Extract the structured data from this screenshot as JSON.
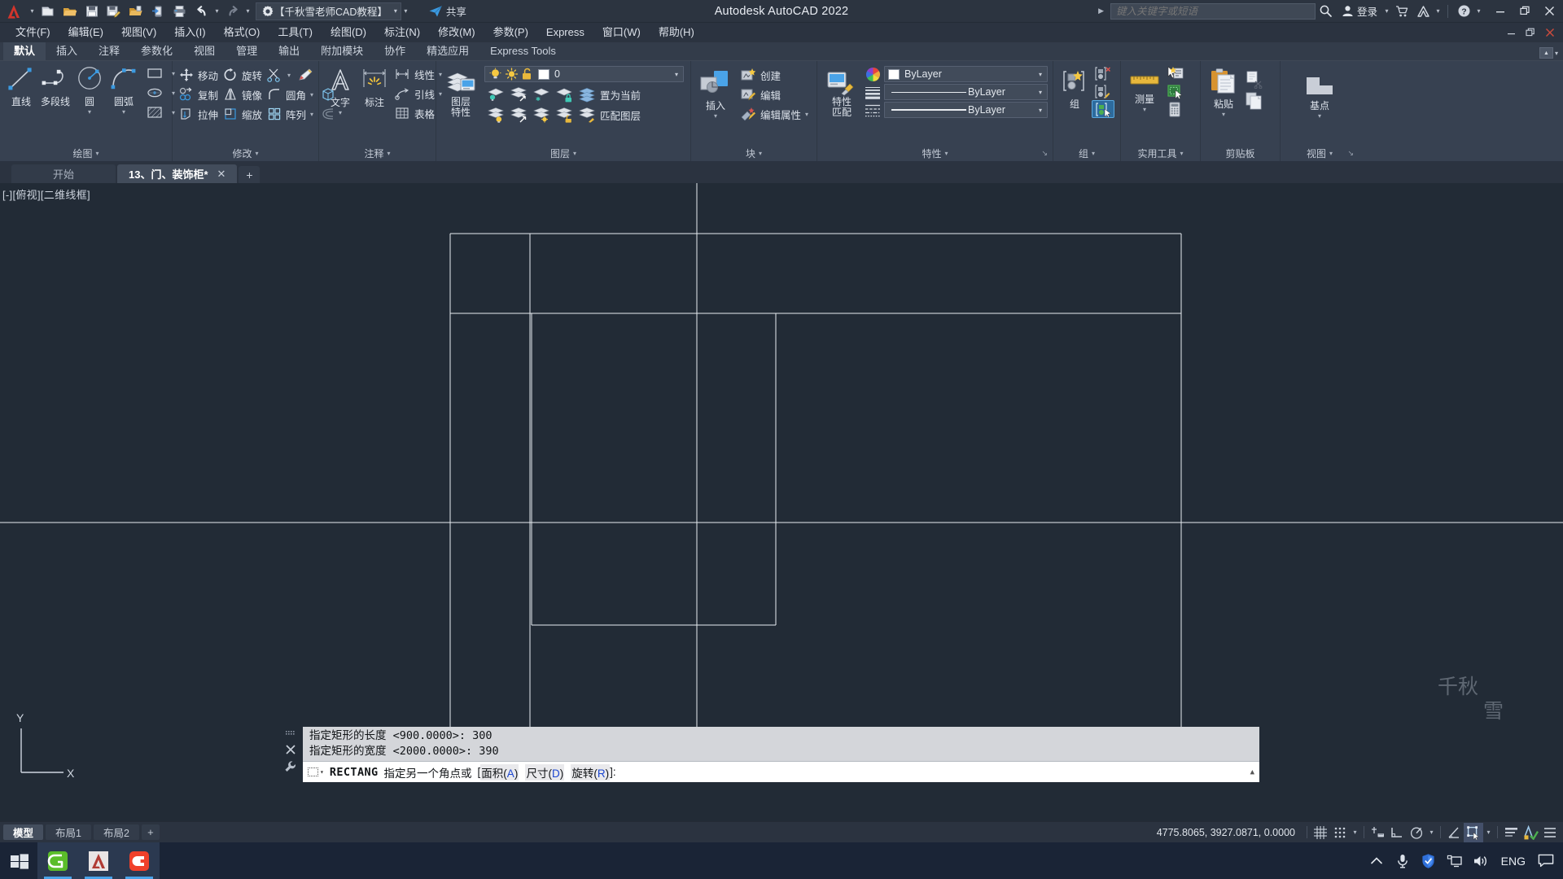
{
  "titlebar": {
    "app_menu_icon": "autocad-a-icon",
    "quick_access": [
      {
        "name": "new-file-icon",
        "label": "新建"
      },
      {
        "name": "open-file-icon",
        "label": "打开"
      },
      {
        "name": "save-icon",
        "label": "保存"
      },
      {
        "name": "save-as-icon",
        "label": "另存为"
      },
      {
        "name": "open-from-web-icon",
        "label": "从 Web 和 Mobile 中打开"
      },
      {
        "name": "save-to-web-icon",
        "label": "保存到 Web 和 Mobile"
      },
      {
        "name": "plot-icon",
        "label": "打印"
      },
      {
        "name": "undo-icon",
        "label": "放弃"
      },
      {
        "name": "redo-icon",
        "label": "重做"
      }
    ],
    "workspace": {
      "icon": "gear-icon",
      "label": "【千秋雪老师CAD教程】",
      "dropdown": "▼"
    },
    "share": {
      "icon": "share-icon",
      "label": "共享"
    },
    "title": "Autodesk AutoCAD 2022",
    "search": {
      "placeholder": "键入关键字或短语",
      "icon": "search-icon",
      "expander": "▶"
    },
    "account": {
      "icon": "user-icon",
      "label": "登录"
    },
    "cart_icon": "cart-icon",
    "autodesk_icon": "autodesk-a-icon",
    "help_icon": "help-question-icon",
    "window_controls": {
      "minimize": "—",
      "restore": "❐",
      "close": "✕"
    }
  },
  "menubar": {
    "items": [
      {
        "label": "文件(F)"
      },
      {
        "label": "编辑(E)"
      },
      {
        "label": "视图(V)"
      },
      {
        "label": "插入(I)"
      },
      {
        "label": "格式(O)"
      },
      {
        "label": "工具(T)"
      },
      {
        "label": "绘图(D)"
      },
      {
        "label": "标注(N)"
      },
      {
        "label": "修改(M)"
      },
      {
        "label": "参数(P)"
      },
      {
        "label": "Express"
      },
      {
        "label": "窗口(W)"
      },
      {
        "label": "帮助(H)"
      }
    ],
    "doc_controls": {
      "minimize": "—",
      "restore": "❐",
      "close": "✕"
    }
  },
  "ribbon_tabs": {
    "tabs": [
      {
        "label": "默认",
        "active": true
      },
      {
        "label": "插入",
        "active": false
      },
      {
        "label": "注释",
        "active": false
      },
      {
        "label": "参数化",
        "active": false
      },
      {
        "label": "视图",
        "active": false
      },
      {
        "label": "管理",
        "active": false
      },
      {
        "label": "输出",
        "active": false
      },
      {
        "label": "附加模块",
        "active": false
      },
      {
        "label": "协作",
        "active": false
      },
      {
        "label": "精选应用",
        "active": false
      },
      {
        "label": "Express Tools",
        "active": false
      }
    ],
    "minimize_ribbon": {
      "icon": "ribbon-minimize-icon",
      "dropdown": "▼"
    }
  },
  "panels": {
    "draw": {
      "title": "绘图",
      "big": [
        {
          "label": "直线",
          "icon": "line-icon",
          "dropdown": false
        },
        {
          "label": "多段线",
          "icon": "polyline-icon",
          "dropdown": false
        },
        {
          "label": "圆",
          "icon": "circle-icon",
          "dropdown": true
        },
        {
          "label": "圆弧",
          "icon": "arc-icon",
          "dropdown": true
        }
      ],
      "small": [
        {
          "label": "矩形",
          "icon": "rectangle-icon",
          "dropdown": true
        },
        {
          "label": "椭圆",
          "icon": "ellipse-icon",
          "dropdown": true
        },
        {
          "label": "图案填充",
          "icon": "hatch-icon",
          "dropdown": true
        }
      ]
    },
    "modify": {
      "title": "修改",
      "rows": [
        [
          {
            "label": "移动",
            "icon": "move-icon"
          },
          {
            "label": "旋转",
            "icon": "rotate-icon"
          },
          {
            "label": "修剪",
            "icon": "trim-icon",
            "dropdown": true
          },
          {
            "label": "",
            "icon": "erase-pencil-icon"
          }
        ],
        [
          {
            "label": "复制",
            "icon": "copy-icon"
          },
          {
            "label": "镜像",
            "icon": "mirror-icon"
          },
          {
            "label": "圆角",
            "icon": "fillet-icon",
            "dropdown": true
          },
          {
            "label": "",
            "icon": "solid-box-icon"
          }
        ],
        [
          {
            "label": "拉伸",
            "icon": "stretch-icon"
          },
          {
            "label": "缩放",
            "icon": "scale-icon"
          },
          {
            "label": "阵列",
            "icon": "array-icon",
            "dropdown": true
          },
          {
            "label": "",
            "icon": "offset-icon"
          }
        ]
      ]
    },
    "annotation": {
      "title": "注释",
      "big": [
        {
          "label": "文字",
          "icon": "text-a-icon",
          "dropdown": true
        },
        {
          "label": "标注",
          "icon": "dimension-icon",
          "dropdown": false
        }
      ],
      "small": [
        {
          "label": "线性",
          "icon": "linear-dim-icon",
          "dropdown": true
        },
        {
          "label": "引线",
          "icon": "leader-icon",
          "dropdown": true
        },
        {
          "label": "表格",
          "icon": "table-icon",
          "dropdown": false
        }
      ]
    },
    "layers": {
      "title": "图层",
      "big": {
        "label1": "图层",
        "label2": "特性",
        "icon": "layer-properties-icon"
      },
      "current_layer": {
        "name": "0",
        "on_icon": "lightbulb-on-icon",
        "freeze_icon": "sun-icon",
        "lock_icon": "unlock-icon",
        "color": "#ffffff",
        "dropdown": "▼"
      },
      "row1": [
        {
          "icon": "layer-isolate-icon"
        },
        {
          "icon": "layer-unisolate-icon"
        },
        {
          "icon": "layer-freeze-icon"
        },
        {
          "icon": "layer-lock-icon"
        },
        {
          "icon": "layer-make-current-icon",
          "label": "置为当前"
        }
      ],
      "row2": [
        {
          "icon": "layer-off-icon"
        },
        {
          "icon": "layer-turn-all-on-icon"
        },
        {
          "icon": "layer-thaw-all-icon"
        },
        {
          "icon": "layer-unlock-icon"
        },
        {
          "icon": "layer-match-icon",
          "label": "匹配图层"
        }
      ]
    },
    "block": {
      "title": "块",
      "big": {
        "label": "插入",
        "icon": "insert-block-icon",
        "dropdown": true
      },
      "small": [
        {
          "label": "创建",
          "icon": "create-block-icon"
        },
        {
          "label": "编辑",
          "icon": "edit-block-icon"
        },
        {
          "label": "编辑属性",
          "icon": "edit-attributes-icon",
          "dropdown": true
        }
      ]
    },
    "properties": {
      "title": "特性",
      "big": {
        "label1": "特性",
        "label2": "匹配",
        "icon": "match-properties-icon"
      },
      "quick_icons": [
        {
          "icon": "color-wheel-icon"
        },
        {
          "icon": "lineweight-list-icon"
        },
        {
          "icon": "linetype-list-icon"
        }
      ],
      "combos": [
        {
          "type": "color",
          "value": "ByLayer",
          "swatch": "#ffffff",
          "dropdown": "▼"
        },
        {
          "type": "lineweight",
          "value": "ByLayer",
          "dropdown": "▼"
        },
        {
          "type": "linetype",
          "value": "ByLayer",
          "dropdown": "▼"
        }
      ],
      "dialog_launcher": "↘"
    },
    "group": {
      "title": "组",
      "big": {
        "label": "组",
        "icon": "group-icon"
      },
      "small": [
        {
          "icon": "ungroup-icon"
        },
        {
          "icon": "group-edit-icon"
        },
        {
          "icon": "group-selection-on-icon",
          "active": true
        }
      ]
    },
    "utilities": {
      "title": "实用工具",
      "big": {
        "label": "测量",
        "icon": "measure-ruler-icon",
        "dropdown": true
      },
      "small": [
        {
          "icon": "quick-select-icon"
        },
        {
          "icon": "select-all-icon"
        },
        {
          "icon": "calculator-icon"
        }
      ]
    },
    "clipboard": {
      "title": "剪贴板",
      "big": {
        "label": "粘贴",
        "icon": "paste-icon",
        "dropdown": true
      },
      "small": [
        {
          "icon": "cut-icon"
        },
        {
          "icon": "copy-clip-icon"
        }
      ]
    },
    "view": {
      "title": "视图",
      "big": {
        "label": "基点",
        "icon": "base-point-icon",
        "dropdown": true
      },
      "dialog_launcher": "↘"
    }
  },
  "document_tabs": {
    "tabs": [
      {
        "label": "开始",
        "active": false,
        "closable": false
      },
      {
        "label": "13、门、装饰柜*",
        "active": true,
        "closable": true
      }
    ],
    "new_tab": "+"
  },
  "viewport": {
    "label": "[-][俯视][二维线框]",
    "watermark": "千秋雪",
    "ucs": {
      "y_label": "Y",
      "x_label": "X"
    }
  },
  "command_line": {
    "history": [
      "指定矩形的长度 <900.0000>: 300",
      "指定矩形的宽度 <2000.0000>: 390"
    ],
    "prompt": {
      "command": "RECTANG",
      "text": "指定另一个角点或",
      "open_bracket": "[",
      "options": [
        {
          "label": "面积",
          "key": "A"
        },
        {
          "label": "尺寸",
          "key": "D"
        },
        {
          "label": "旋转",
          "key": "R"
        }
      ],
      "close_bracket": "]:",
      "scroll": "▲"
    },
    "gutter": [
      {
        "icon": "drag-handle-icon"
      },
      {
        "icon": "close-command-icon"
      },
      {
        "icon": "customize-wrench-icon"
      }
    ]
  },
  "status_bar": {
    "tabs": [
      {
        "label": "模型",
        "active": true
      },
      {
        "label": "布局1",
        "active": false
      },
      {
        "label": "布局2",
        "active": false
      }
    ],
    "new_layout": "+",
    "coordinates": "4775.8065, 3927.0871, 0.0000",
    "toggles": [
      {
        "name": "grid-display-icon",
        "active": false
      },
      {
        "name": "snap-mode-icon",
        "active": false
      },
      {
        "name": "snap-dropdown",
        "active": false
      },
      {
        "name": "infer-constraints-icon",
        "active": false
      },
      {
        "name": "ortho-mode-icon",
        "active": false
      },
      {
        "name": "polar-tracking-icon",
        "active": false
      },
      {
        "name": "polar-dropdown",
        "active": false
      },
      {
        "name": "isometric-drafting-icon",
        "active": false
      },
      {
        "name": "object-snap-icon",
        "active": true
      },
      {
        "name": "osnap-dropdown",
        "active": false
      },
      {
        "name": "lineweight-display-icon",
        "active": false
      },
      {
        "name": "annotation-visibility-icon",
        "active": false
      },
      {
        "name": "customization-menu-icon",
        "active": false
      }
    ]
  },
  "taskbar": {
    "start_icon": "windows-start-icon",
    "apps": [
      {
        "name": "taskbar-app-green-icon",
        "active": true
      },
      {
        "name": "taskbar-app-autocad-icon",
        "active": true
      },
      {
        "name": "taskbar-app-c-icon",
        "active": true
      }
    ],
    "tray": {
      "chevron": "^",
      "icons": [
        "microphone-icon",
        "shield-security-icon",
        "network-display-icon",
        "volume-icon"
      ],
      "language": "ENG",
      "notifications": "notification-icon"
    }
  },
  "colors": {
    "canvas_bg": "#222b36",
    "ribbon_bg": "#374151",
    "chrome_bg": "#2b3340",
    "accent": "#4aa3e8",
    "drawing_line": "#e8ecf1"
  }
}
